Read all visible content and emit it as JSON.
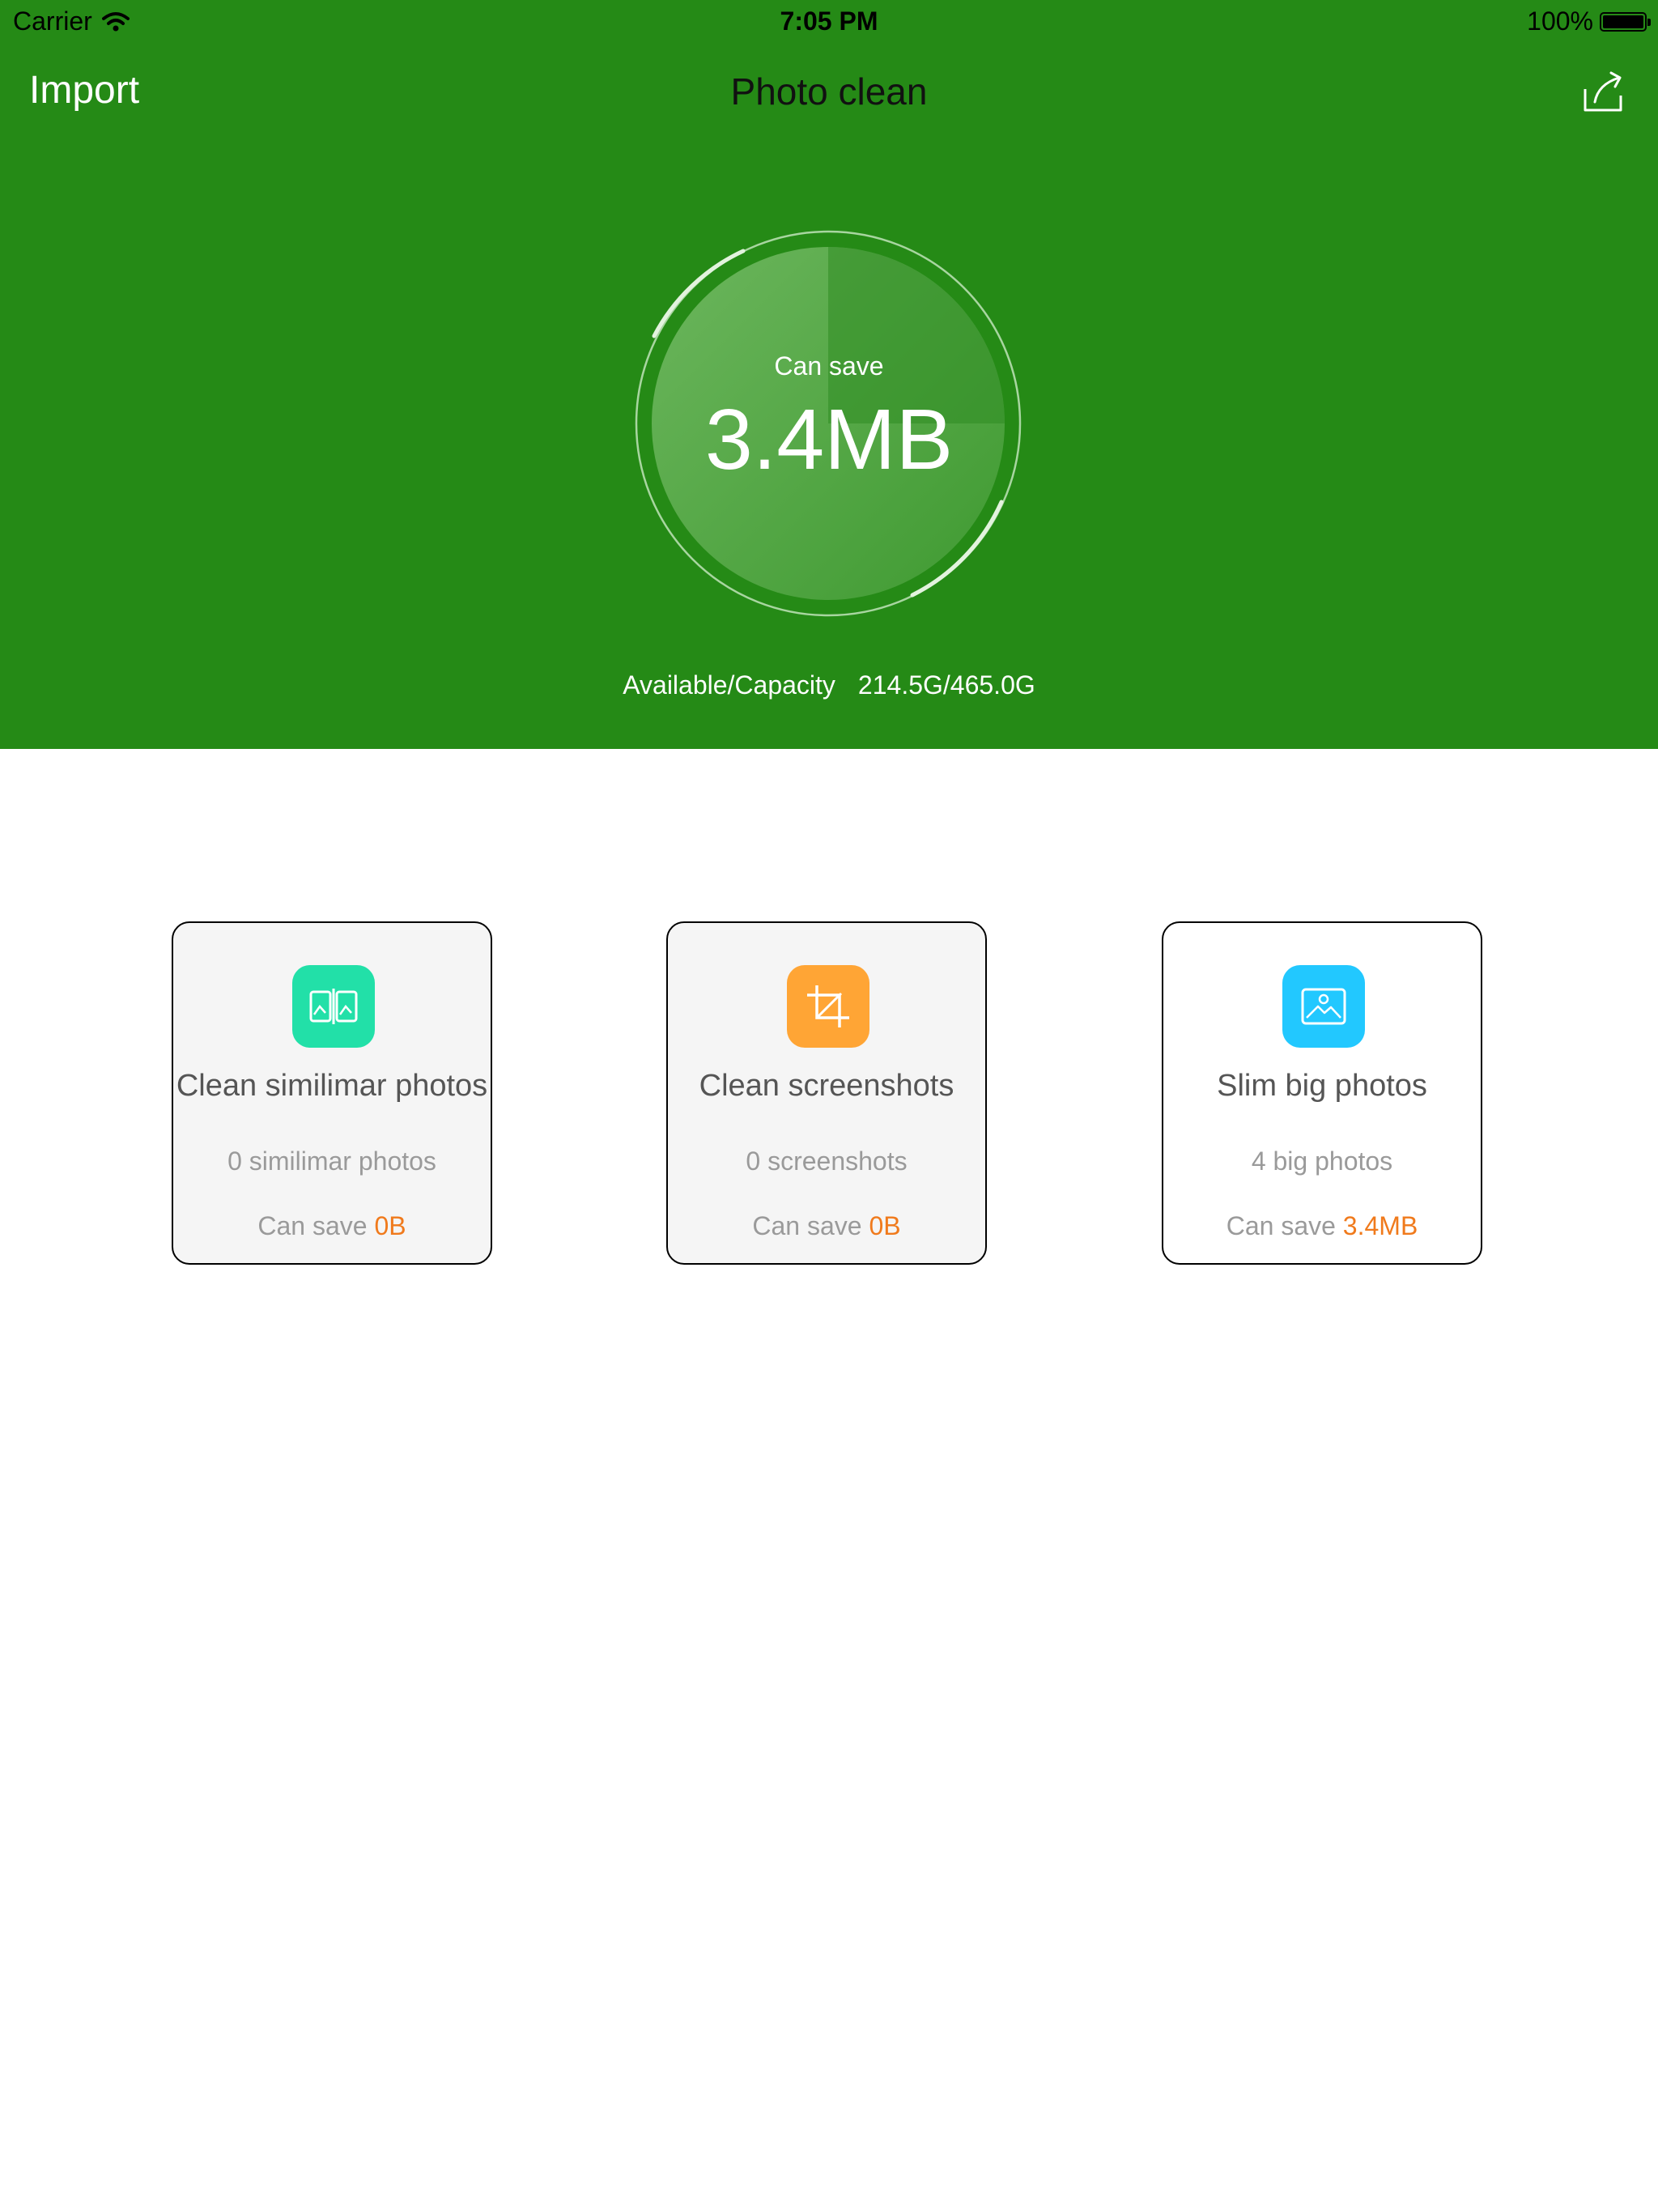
{
  "status_bar": {
    "carrier": "Carrier",
    "time": "7:05 PM",
    "battery": "100%"
  },
  "nav": {
    "left_label": "Import",
    "title": "Photo clean",
    "right_icon": "share-icon"
  },
  "summary": {
    "label": "Can save",
    "value": "3.4MB",
    "capacity_label": "Available/Capacity",
    "capacity_value": "214.5G/465.0G"
  },
  "cards": [
    {
      "title": "Clean similimar photos",
      "count": "0 similimar photos",
      "save_label": "Can save",
      "save_amount": "0B",
      "icon": "similar-photos-icon",
      "icon_color": "#22e0a8"
    },
    {
      "title": "Clean screenshots",
      "count": "0 screenshots",
      "save_label": "Can save",
      "save_amount": "0B",
      "icon": "crop-icon",
      "icon_color": "#ffa535"
    },
    {
      "title": "Slim big photos",
      "count": "4 big photos",
      "save_label": "Can save",
      "save_amount": "3.4MB",
      "icon": "image-icon",
      "icon_color": "#22c8ff"
    }
  ],
  "colors": {
    "header_bg": "#258a16",
    "accent_orange": "#f07a1c"
  }
}
